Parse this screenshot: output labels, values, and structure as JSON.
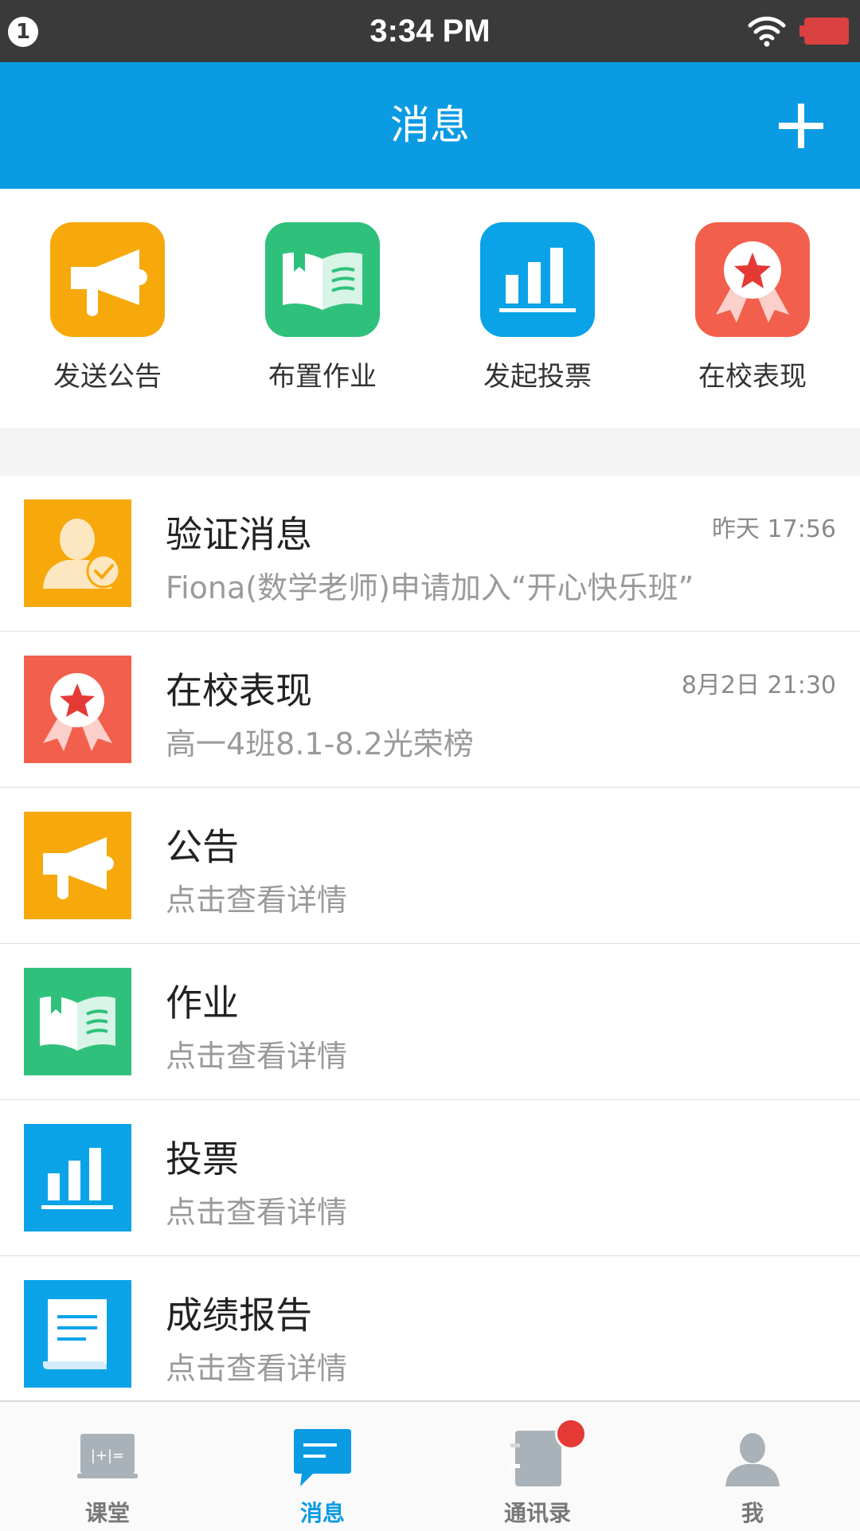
{
  "status_bar": {
    "notification_count": "1",
    "time": "3:34 PM",
    "icons": [
      "wifi-icon",
      "battery-icon"
    ]
  },
  "header": {
    "title": "消息",
    "add_icon": "plus-icon"
  },
  "quick_actions": [
    {
      "label": "发送公告",
      "icon": "megaphone-icon",
      "color": "#f7a80a"
    },
    {
      "label": "布置作业",
      "icon": "book-icon",
      "color": "#2fc17b"
    },
    {
      "label": "发起投票",
      "icon": "bar-chart-icon",
      "color": "#0aa3e8"
    },
    {
      "label": "在校表现",
      "icon": "award-icon",
      "color": "#f25f4c"
    }
  ],
  "messages": [
    {
      "title": "验证消息",
      "subtitle": "Fiona(数学老师)申请加入“开心快乐班”",
      "time": "昨天 17:56",
      "icon": "user-verify-icon",
      "color": "#f7a80a"
    },
    {
      "title": "在校表现",
      "subtitle": "高一4班8.1-8.2光荣榜",
      "time": "8月2日 21:30",
      "icon": "award-icon",
      "color": "#f25f4c"
    },
    {
      "title": "公告",
      "subtitle": "点击查看详情",
      "time": "",
      "icon": "megaphone-icon",
      "color": "#f7a80a"
    },
    {
      "title": "作业",
      "subtitle": "点击查看详情",
      "time": "",
      "icon": "book-icon",
      "color": "#2fc17b"
    },
    {
      "title": "投票",
      "subtitle": "点击查看详情",
      "time": "",
      "icon": "bar-chart-icon",
      "color": "#0aa3e8"
    },
    {
      "title": "成绩报告",
      "subtitle": "点击查看详情",
      "time": "",
      "icon": "report-icon",
      "color": "#0aa3e8"
    }
  ],
  "tabs": [
    {
      "label": "课堂",
      "icon": "classroom-icon",
      "active": false
    },
    {
      "label": "消息",
      "icon": "message-icon",
      "active": true
    },
    {
      "label": "通讯录",
      "icon": "contacts-icon",
      "active": false,
      "has_badge": true
    },
    {
      "label": "我",
      "icon": "profile-icon",
      "active": false
    }
  ],
  "colors": {
    "primary": "#0a9be3",
    "badge": "#e53935"
  }
}
